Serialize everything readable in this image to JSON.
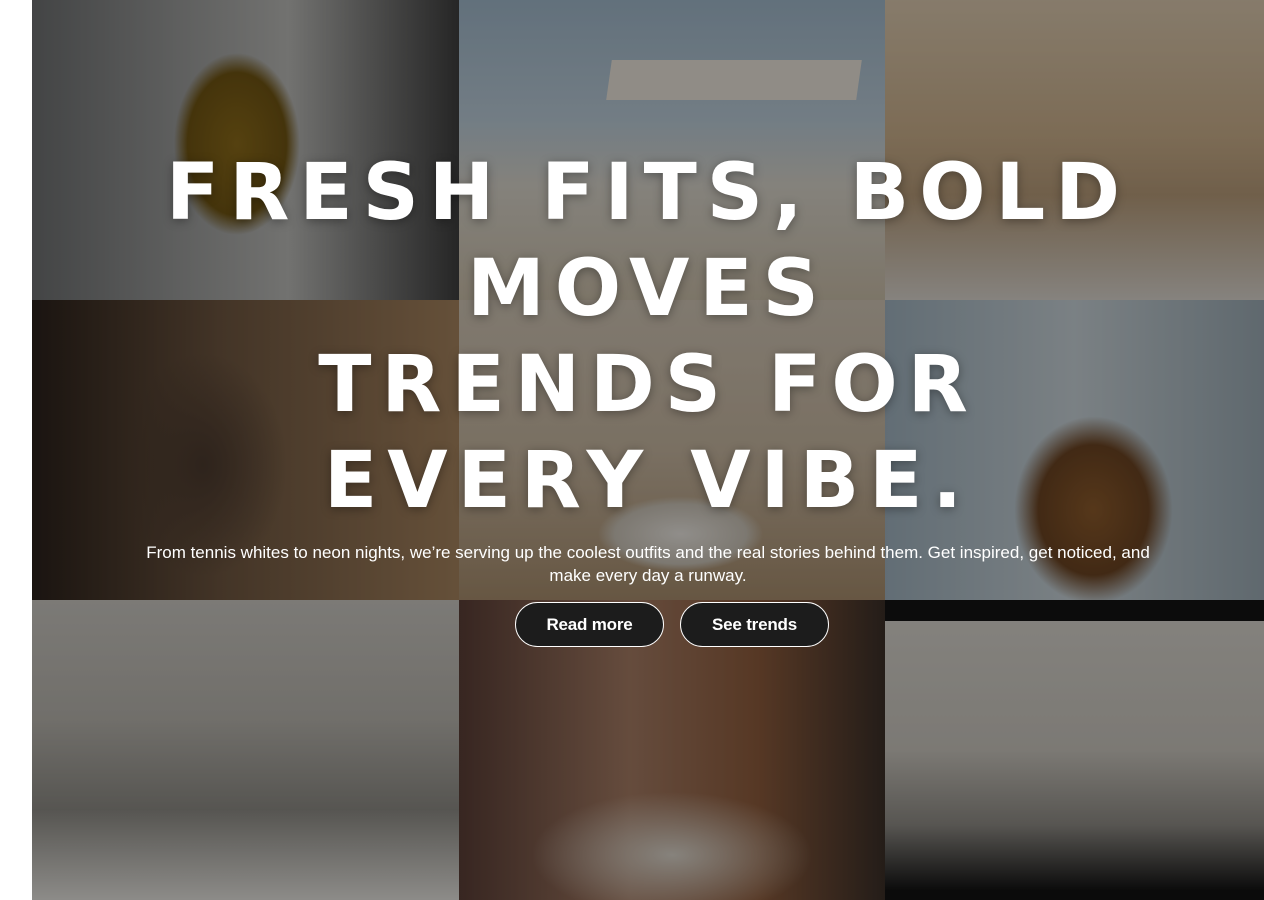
{
  "hero": {
    "headline_lines": [
      "FRESH FITS, BOLD",
      "MOVES",
      "TRENDS FOR",
      "EVERY VIBE."
    ],
    "subtitle": "From tennis whites to neon nights, we’re serving up the coolest outfits and the real stories behind them. Get inspired, get noticed, and make every day a runway.",
    "buttons": {
      "read_more": "Read more",
      "see_trends": "See trends"
    }
  },
  "colors": {
    "overlay": "#000000",
    "text": "#ffffff",
    "button_bg": "#1c1c1c",
    "button_border": "#ffffff"
  }
}
